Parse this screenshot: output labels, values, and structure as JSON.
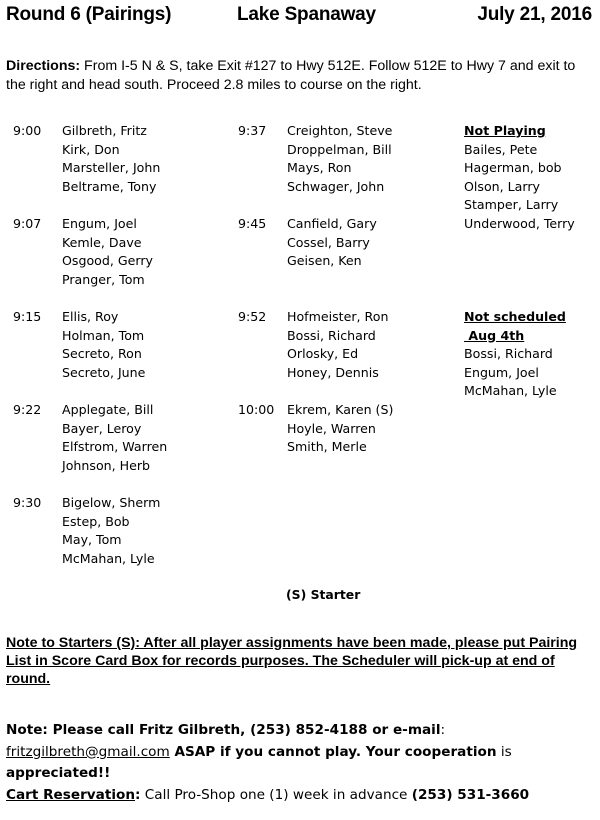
{
  "header": {
    "title": "Round 6 (Pairings)",
    "course": "Lake Spanaway",
    "date": "July 21, 2016"
  },
  "directions": {
    "label": "Directions:",
    "text": " From I-5 N & S, take Exit #127 to Hwy 512E. Follow 512E to Hwy 7 and exit to the right and head south. Proceed 2.8 miles to course on the right."
  },
  "tee_times": [
    {
      "time": "9:00",
      "players": [
        "Gilbreth, Fritz",
        "Kirk, Don",
        "Marsteller, John",
        "Beltrame, Tony"
      ]
    },
    {
      "time": "9:07",
      "players": [
        "Engum, Joel",
        "Kemle, Dave",
        "Osgood, Gerry",
        "Pranger, Tom"
      ]
    },
    {
      "time": "9:15",
      "players": [
        "Ellis, Roy",
        "Holman, Tom",
        "Secreto, Ron",
        "Secreto, June"
      ]
    },
    {
      "time": "9:22",
      "players": [
        "Applegate, Bill",
        "Bayer, Leroy",
        "Elfstrom, Warren",
        "Johnson, Herb"
      ]
    },
    {
      "time": "9:30",
      "players": [
        "Bigelow, Sherm",
        "Estep, Bob",
        "May, Tom",
        "McMahan, Lyle"
      ]
    },
    {
      "time": "9:37",
      "players": [
        "Creighton, Steve",
        "Droppelman, Bill",
        "Mays, Ron",
        "Schwager, John"
      ]
    },
    {
      "time": "9:45",
      "players": [
        "Canfield, Gary",
        "Cossel, Barry",
        "Geisen, Ken"
      ]
    },
    {
      "time": "9:52",
      "players": [
        "Hofmeister, Ron",
        "Bossi, Richard",
        "Orlosky, Ed",
        "Honey, Dennis"
      ]
    },
    {
      "time": "10:00",
      "players": [
        "Ekrem, Karen (S)",
        "Hoyle, Warren",
        "Smith, Merle"
      ]
    }
  ],
  "not_playing": {
    "heading": "Not Playing",
    "players": [
      "Bailes, Pete",
      "Hagerman, bob",
      "Olson, Larry",
      "Stamper, Larry",
      "Underwood, Terry"
    ]
  },
  "not_scheduled": {
    "heading_line1": "Not scheduled",
    "heading_line2": " Aug 4th",
    "players": [
      "Bossi, Richard",
      "Engum, Joel",
      "McMahan, Lyle"
    ]
  },
  "starter_legend": "(S) Starter",
  "note_to_starters": "Note to Starters (S): After all player assignments have been made, please put Pairing List in Score Card Box for records purposes. The Scheduler will pick-up at end of round.",
  "contact": {
    "note_prefix": "Note: Please call Fritz Gilbreth, (253) 852-4188 or e-mail",
    "colon": ":",
    "email": "fritzgilbreth@gmail.com",
    "note_suffix": " ASAP if you cannot play. Your cooperation",
    "is_word": " is",
    "appreciated": "appreciated!!",
    "cart_label": "Cart Reservation",
    "cart_colon": ":",
    "cart_text": " Call Pro-Shop one (1) week in advance ",
    "cart_phone": "(253) 531-3660"
  }
}
